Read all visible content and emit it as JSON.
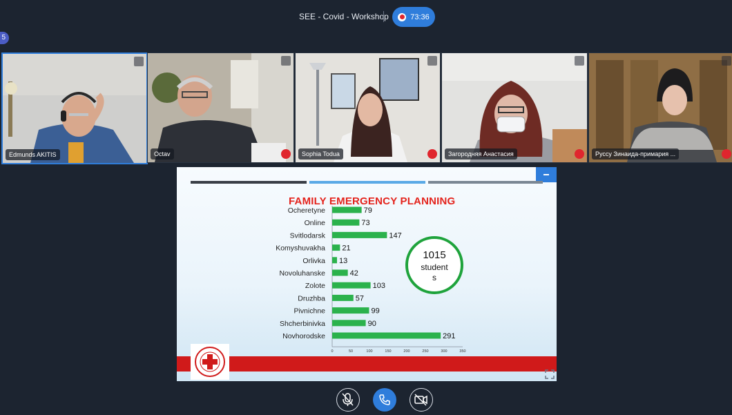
{
  "meeting": {
    "title": "SEE - Covid - Workshop",
    "recording_time": "73:36",
    "participants_badge": "5"
  },
  "participants": [
    {
      "name": "Edmunds AKITIS",
      "active": true,
      "muted": false
    },
    {
      "name": "Octav",
      "active": false,
      "muted": true
    },
    {
      "name": "Sophia Todua",
      "active": false,
      "muted": true
    },
    {
      "name": "Загородняя Анастасия",
      "active": false,
      "muted": true
    },
    {
      "name": "Руссу Зинаида-примария ...",
      "active": false,
      "muted": true
    }
  ],
  "slide": {
    "title": "FAMILY EMERGENCY PLANNING",
    "total_value": "1015",
    "total_label_line1": "student",
    "total_label_line2": "s"
  },
  "chart_data": {
    "type": "bar",
    "orientation": "horizontal",
    "title": "FAMILY EMERGENCY PLANNING",
    "categories": [
      "Ocheretyne",
      "Online",
      "Svitlodarsk",
      "Komyshuvakha",
      "Orlivka",
      "Novoluhanske",
      "Zolote",
      "Druzhba",
      "Pivnichne",
      "Shcherbinivka",
      "Novhorodske"
    ],
    "values": [
      79,
      73,
      147,
      21,
      13,
      42,
      103,
      57,
      99,
      90,
      291
    ],
    "xlim": [
      0,
      350
    ],
    "xticks": [
      0,
      50,
      100,
      150,
      200,
      250,
      300,
      350
    ],
    "grid": false,
    "bar_color": "#2bb24c"
  },
  "colors": {
    "background": "#1c2430",
    "accent": "#2f7ddb",
    "record": "#e0262e",
    "slide_title": "#e4231c",
    "bar": "#2bb24c",
    "circle": "#1fa33c"
  },
  "controls": [
    {
      "icon": "microphone-off-icon"
    },
    {
      "icon": "phone-icon"
    },
    {
      "icon": "camera-off-icon"
    }
  ]
}
